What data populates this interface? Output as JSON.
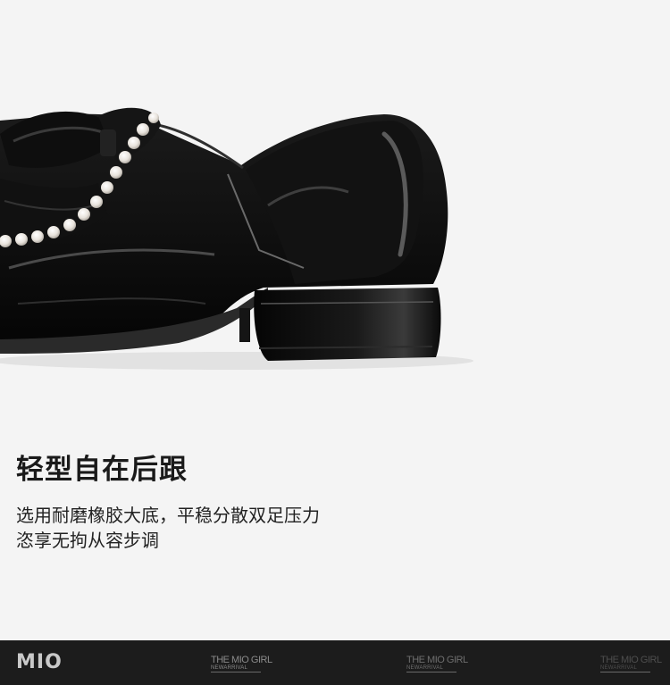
{
  "heading": "轻型自在后跟",
  "description": {
    "line1": "选用耐磨橡胶大底，平稳分散双足压力",
    "line2": "恣享无拘从容步调"
  },
  "footer": {
    "logo": "MIO",
    "watermarks": [
      {
        "title": "THE MIO GIRL",
        "subtitle": "NEWARRIVAL"
      },
      {
        "title": "THE MIO GIRL",
        "subtitle": "NEWARRIVAL"
      },
      {
        "title": "THE MIO GIRL",
        "subtitle": "NEWARRIVAL"
      }
    ]
  },
  "colors": {
    "background": "#f4f4f4",
    "footer": "#1c1c1c",
    "shoe": "#0b0b0b"
  }
}
